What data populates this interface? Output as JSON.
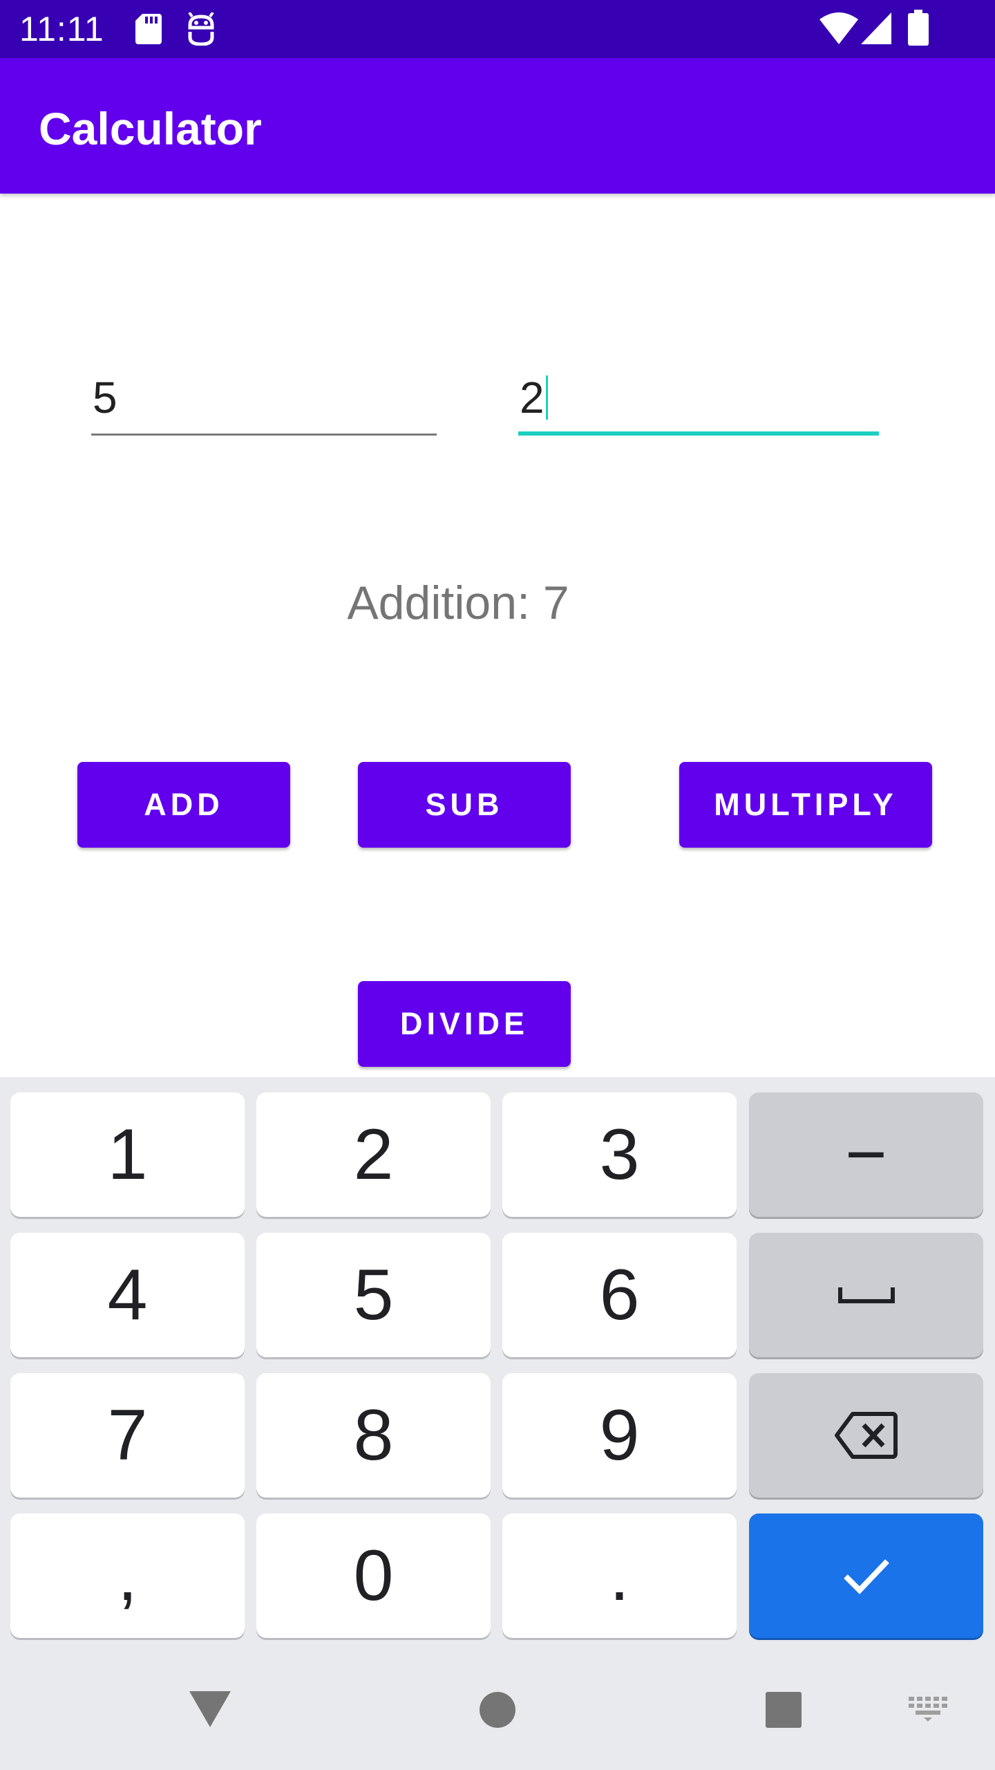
{
  "status_bar": {
    "time": "11:11",
    "icons": [
      "sd-card-icon",
      "android-debug-icon",
      "wifi-icon",
      "signal-icon",
      "battery-icon"
    ]
  },
  "app_bar": {
    "title": "Calculator"
  },
  "inputs": {
    "first_number": "5",
    "second_number": "2"
  },
  "result": {
    "text": "Addition: 7"
  },
  "buttons": {
    "add": "ADD",
    "sub": "SUB",
    "multiply": "MULTIPLY",
    "divide": "DIVIDE"
  },
  "keyboard": {
    "rows": [
      [
        "1",
        "2",
        "3",
        "-"
      ],
      [
        "4",
        "5",
        "6",
        "space"
      ],
      [
        "7",
        "8",
        "9",
        "backspace"
      ],
      [
        ",",
        "0",
        ".",
        "done"
      ]
    ],
    "labels": {
      "k1": "1",
      "k2": "2",
      "k3": "3",
      "minus": "−",
      "k4": "4",
      "k5": "5",
      "k6": "6",
      "k7": "7",
      "k8": "8",
      "k9": "9",
      "comma": ",",
      "k0": "0",
      "period": "."
    }
  },
  "nav_bar": {
    "icons": [
      "back-icon",
      "home-icon",
      "recents-icon",
      "keyboard-switch-icon"
    ]
  },
  "colors": {
    "status_bar": "#3700B3",
    "primary": "#6200EE",
    "accent": "#1ccfc0",
    "keyboard_bg": "#e8eaed",
    "done_key": "#1a73e8"
  }
}
